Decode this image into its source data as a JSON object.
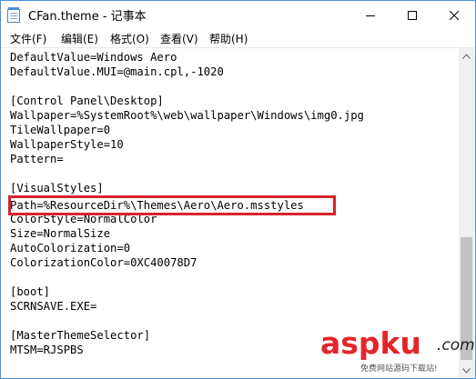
{
  "window": {
    "title": "CFan.theme - 记事本"
  },
  "menu": {
    "items": [
      "文件(F)",
      "编辑(E)",
      "格式(O)",
      "查看(V)",
      "帮助(H)"
    ]
  },
  "editor": {
    "lines": [
      "DefaultValue=Windows Aero",
      "DefaultValue.MUI=@main.cpl,-1020",
      "",
      "[Control Panel\\Desktop]",
      "Wallpaper=%SystemRoot%\\web\\wallpaper\\Windows\\img0.jpg",
      "TileWallpaper=0",
      "WallpaperStyle=10",
      "Pattern=",
      "",
      "[VisualStyles]",
      "Path=%ResourceDir%\\Themes\\Aero\\Aero.msstyles",
      "ColorStyle=NormalColor",
      "Size=NormalSize",
      "AutoColorization=0",
      "ColorizationColor=0XC40078D7",
      "",
      "[boot]",
      "SCRNSAVE.EXE=",
      "",
      "[MasterThemeSelector]",
      "MTSM=RJSPBS"
    ],
    "highlighted_line_index": 10
  },
  "watermark": {
    "main": "aspku",
    "tld": ".com",
    "sub": "免费网站源码下载站!"
  },
  "colors": {
    "highlight": "#d6242b",
    "window_border": "#4a8fd8",
    "watermark": "#e3262b"
  },
  "icons": {
    "app": "notepad-icon",
    "minimize": "minimize-icon",
    "maximize": "maximize-icon",
    "close": "close-icon"
  }
}
